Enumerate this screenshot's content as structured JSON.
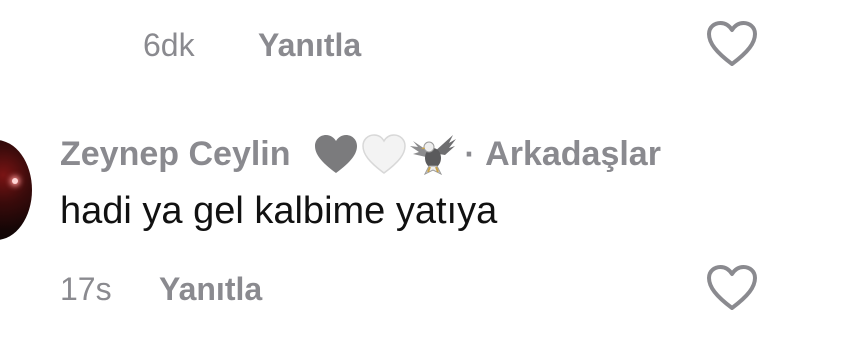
{
  "prev_comment": {
    "time": "6dk",
    "reply_label": "Yanıtla"
  },
  "comment": {
    "author": "Zeynep Ceylin",
    "separator": "·",
    "tag": "Arkadaşlar",
    "text": "hadi ya gel kalbime yatıya",
    "time": "17s",
    "reply_label": "Yanıtla",
    "badges": [
      "grey-heart-icon",
      "white-heart-icon",
      "eagle-icon"
    ]
  },
  "colors": {
    "meta": "#8a8a8f",
    "text": "#111111",
    "background": "#ffffff"
  }
}
